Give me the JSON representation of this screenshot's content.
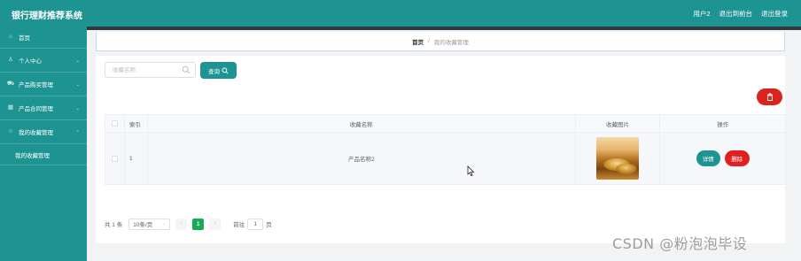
{
  "app": {
    "title": "银行理财推荐系统"
  },
  "header": {
    "user": "用户2",
    "back_to_admin": "退出到前台",
    "logout": "退出登录"
  },
  "sidebar": {
    "items": [
      {
        "label": "首页",
        "icon": "home-icon",
        "has_children": false
      },
      {
        "label": "个人中心",
        "icon": "user-icon",
        "has_children": true
      },
      {
        "label": "产品购买管理",
        "icon": "cart-icon",
        "has_children": true
      },
      {
        "label": "产品合同管理",
        "icon": "grid-icon",
        "has_children": true
      },
      {
        "label": "我的收藏管理",
        "icon": "star-icon",
        "has_children": true,
        "expanded": true
      }
    ],
    "sub_item": "我的收藏管理"
  },
  "breadcrumb": {
    "home": "首页",
    "separator": "/",
    "current": "我的收藏管理"
  },
  "search": {
    "placeholder": "收藏名称",
    "value": "",
    "button": "查询"
  },
  "table": {
    "headers": {
      "index": "索引",
      "name": "收藏名称",
      "image": "收藏图片",
      "actions": "操作"
    },
    "rows": [
      {
        "index": "1",
        "name": "产品名称2",
        "detail": "详情",
        "delete": "删除"
      }
    ]
  },
  "pagination": {
    "total": "共 1 条",
    "page_size": "10条/页",
    "current_page": "1",
    "goto_prefix": "前往",
    "goto_value": "1",
    "goto_suffix": "页"
  },
  "watermark": "CSDN @粉泡泡毕设",
  "colors": {
    "accent": "#1e9492",
    "danger": "#e02020",
    "active_page": "#1aaa55"
  }
}
